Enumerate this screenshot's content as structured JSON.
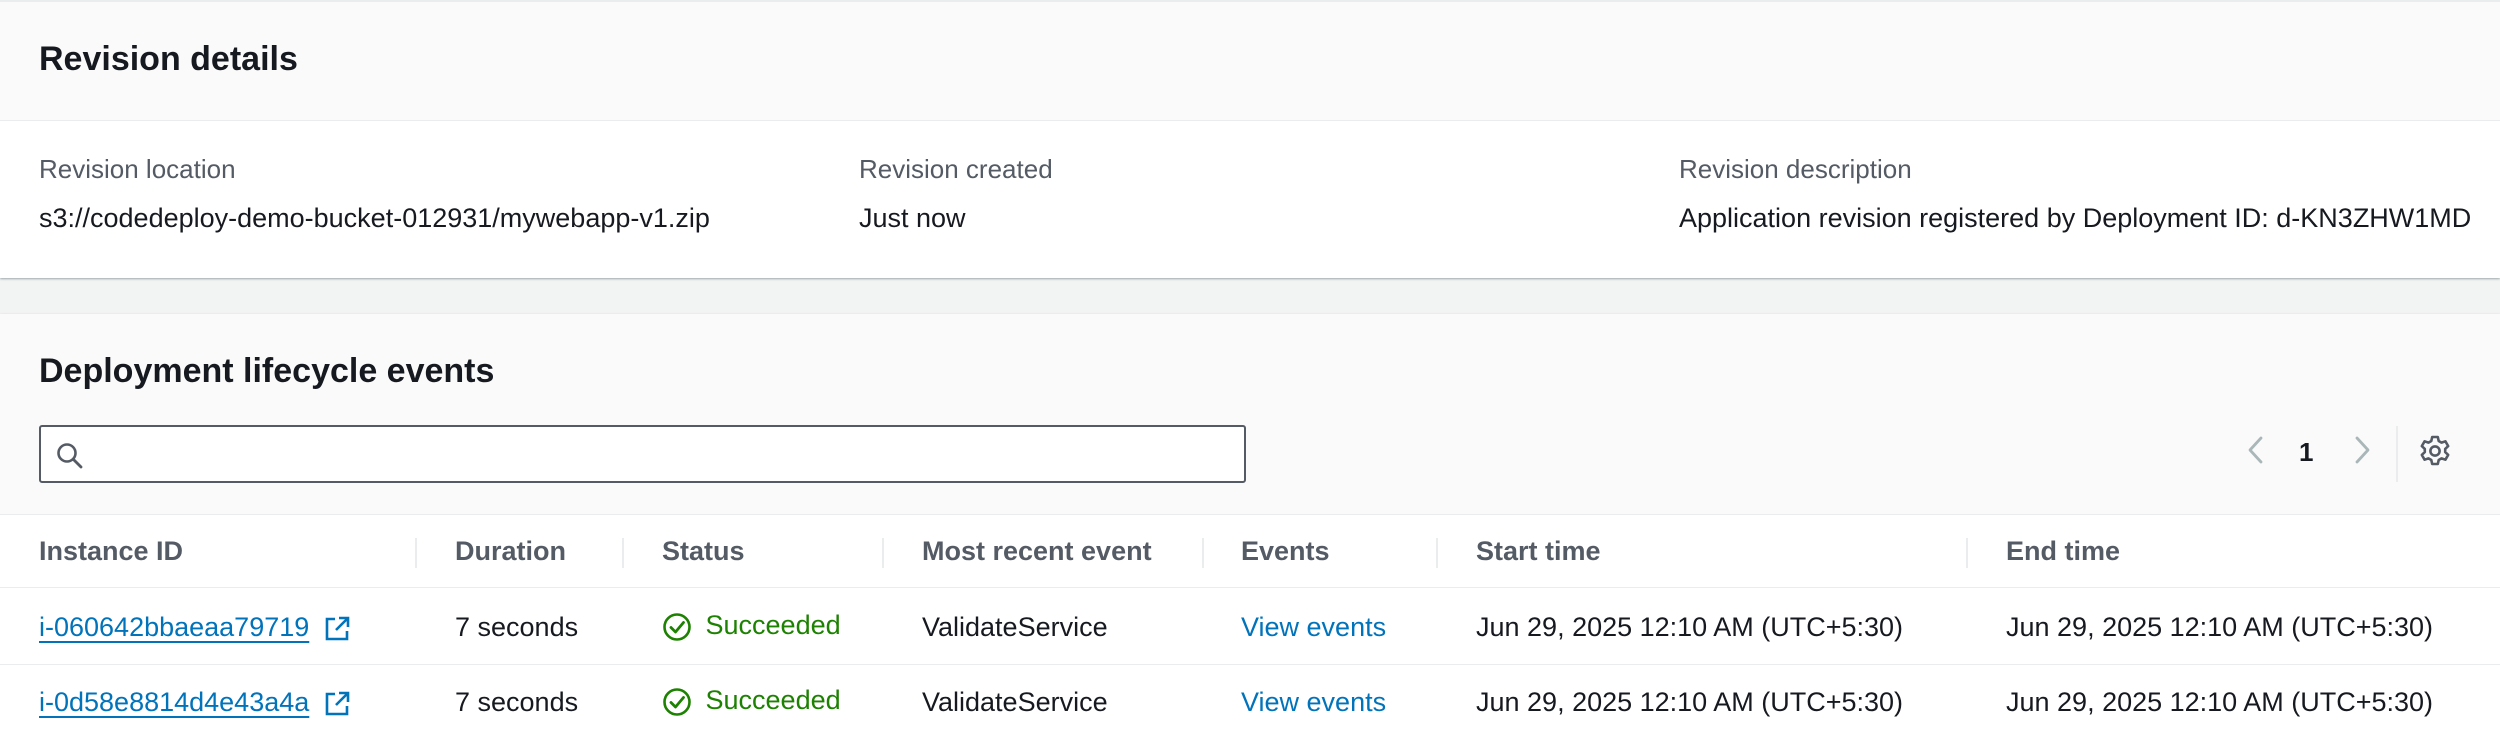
{
  "revision": {
    "title": "Revision details",
    "location_label": "Revision location",
    "location_value": "s3://codedeploy-demo-bucket-012931/mywebapp-v1.zip",
    "created_label": "Revision created",
    "created_value": "Just now",
    "description_label": "Revision description",
    "description_value": "Application revision registered by Deployment ID: d-KN3ZHW1MD"
  },
  "events": {
    "title": "Deployment lifecycle events",
    "search_value": "",
    "page_number": "1",
    "columns": [
      "Instance ID",
      "Duration",
      "Status",
      "Most recent event",
      "Events",
      "Start time",
      "End time"
    ],
    "rows": [
      {
        "instance_id": "i-060642bbaeaa79719",
        "duration": "7 seconds",
        "status": "Succeeded",
        "recent_event": "ValidateService",
        "events_link": "View events",
        "start_time": "Jun 29, 2025 12:10 AM (UTC+5:30)",
        "end_time": "Jun 29, 2025 12:10 AM (UTC+5:30)"
      },
      {
        "instance_id": "i-0d58e8814d4e43a4a",
        "duration": "7 seconds",
        "status": "Succeeded",
        "recent_event": "ValidateService",
        "events_link": "View events",
        "start_time": "Jun 29, 2025 12:10 AM (UTC+5:30)",
        "end_time": "Jun 29, 2025 12:10 AM (UTC+5:30)"
      }
    ]
  },
  "colors": {
    "link": "#0073bb",
    "success": "#1d8102",
    "header_bg": "#fafafa",
    "text": "#16191f",
    "muted": "#545b64"
  }
}
